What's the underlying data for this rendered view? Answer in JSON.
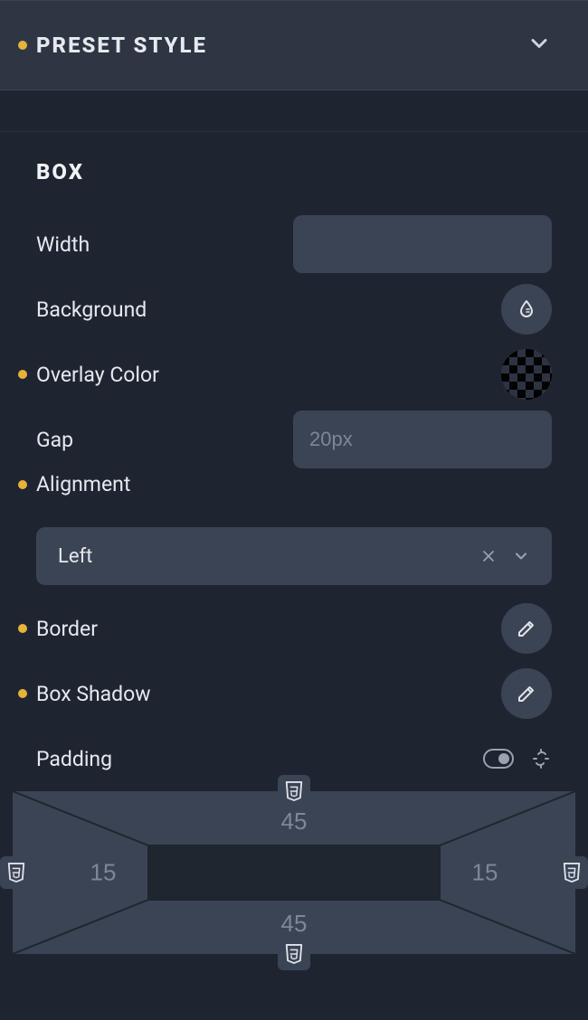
{
  "accordion": {
    "title": "PRESET STYLE",
    "modified": true
  },
  "section": {
    "title": "BOX"
  },
  "box": {
    "width": {
      "label": "Width",
      "value": ""
    },
    "background": {
      "label": "Background"
    },
    "overlay_color": {
      "label": "Overlay Color",
      "modified": true,
      "value": "transparent"
    },
    "gap": {
      "label": "Gap",
      "value": "",
      "placeholder": "20px"
    },
    "alignment": {
      "label": "Alignment",
      "modified": true,
      "value": "Left"
    },
    "border": {
      "label": "Border",
      "modified": true
    },
    "box_shadow": {
      "label": "Box Shadow",
      "modified": true
    },
    "padding": {
      "label": "Padding",
      "linked": false,
      "top": "45",
      "right": "15",
      "bottom": "45",
      "left": "15"
    }
  }
}
